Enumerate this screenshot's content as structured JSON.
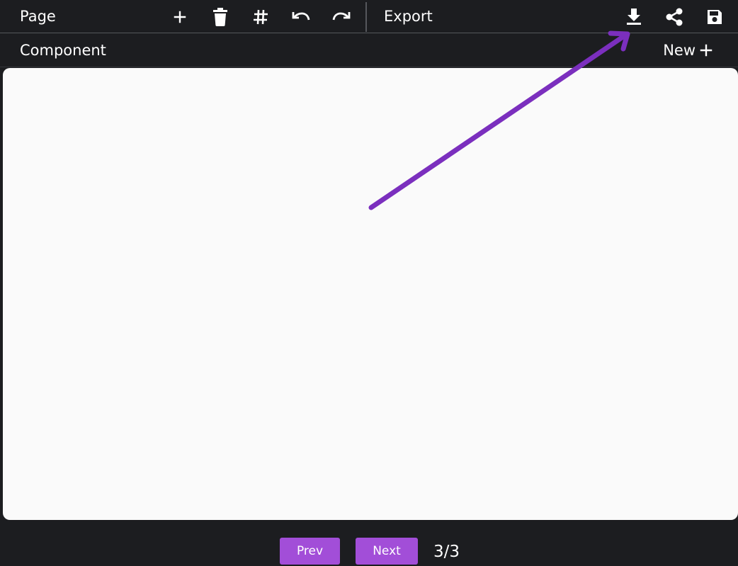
{
  "toolbar": {
    "page_label": "Page",
    "export_label": "Export",
    "page_actions": [
      {
        "name": "add-page",
        "icon": "plus-icon"
      },
      {
        "name": "delete-page",
        "icon": "trash-icon"
      },
      {
        "name": "toggle-grid",
        "icon": "hash-icon"
      },
      {
        "name": "undo",
        "icon": "undo-icon"
      },
      {
        "name": "redo",
        "icon": "redo-icon"
      }
    ],
    "export_actions": [
      {
        "name": "download",
        "icon": "download-icon"
      },
      {
        "name": "share",
        "icon": "share-icon"
      },
      {
        "name": "save",
        "icon": "floppy-disk-icon"
      }
    ]
  },
  "component_bar": {
    "label": "Component",
    "new_label": "New",
    "new_icon": "plus-icon"
  },
  "canvas": {
    "background": "#fafafa"
  },
  "annotation": {
    "type": "arrow",
    "color": "#7b2fbe",
    "points_to": "download-icon"
  },
  "pagination": {
    "prev_label": "Prev",
    "next_label": "Next",
    "indicator": "3/3"
  },
  "colors": {
    "background": "#1c1d20",
    "accent": "#a24ed8",
    "divider": "#55575c"
  }
}
